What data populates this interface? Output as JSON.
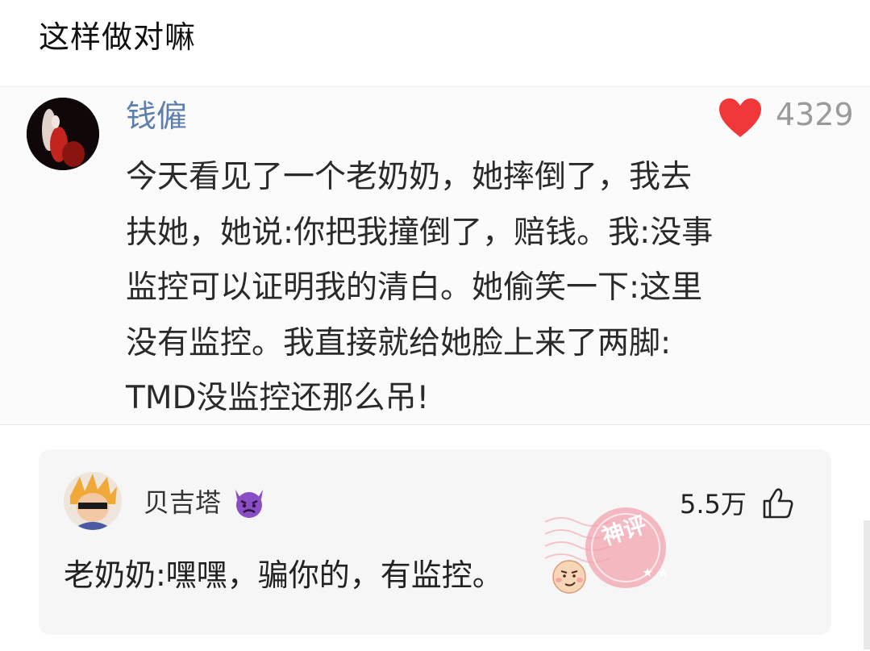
{
  "post": {
    "title": "这样做对嘛"
  },
  "screenshot": {
    "username": "钱僱",
    "likes": "4329",
    "body_lines": [
      "今天看见了一个老奶奶，她摔倒了，我去",
      "扶她，她说:你把我撞倒了，赔钱。我:没事",
      "监控可以证明我的清白。她偷笑一下:这里",
      "没有监控。我直接就给她脸上来了两脚:",
      "TMD没监控还那么吊!"
    ]
  },
  "comment": {
    "username": "贝吉塔",
    "likes": "5.5万",
    "text": "老奶奶:嘿嘿，骗你的，有监控。",
    "stamp_label": "神评",
    "icons": [
      "devil-emoji-icon",
      "thumbs-up-icon",
      "smirk-face-icon",
      "heart-icon"
    ]
  },
  "colors": {
    "heart": "#f0383b",
    "username_blue": "#5d7fae",
    "stamp": "#f2a3ae",
    "devil": "#8a4ec4"
  }
}
